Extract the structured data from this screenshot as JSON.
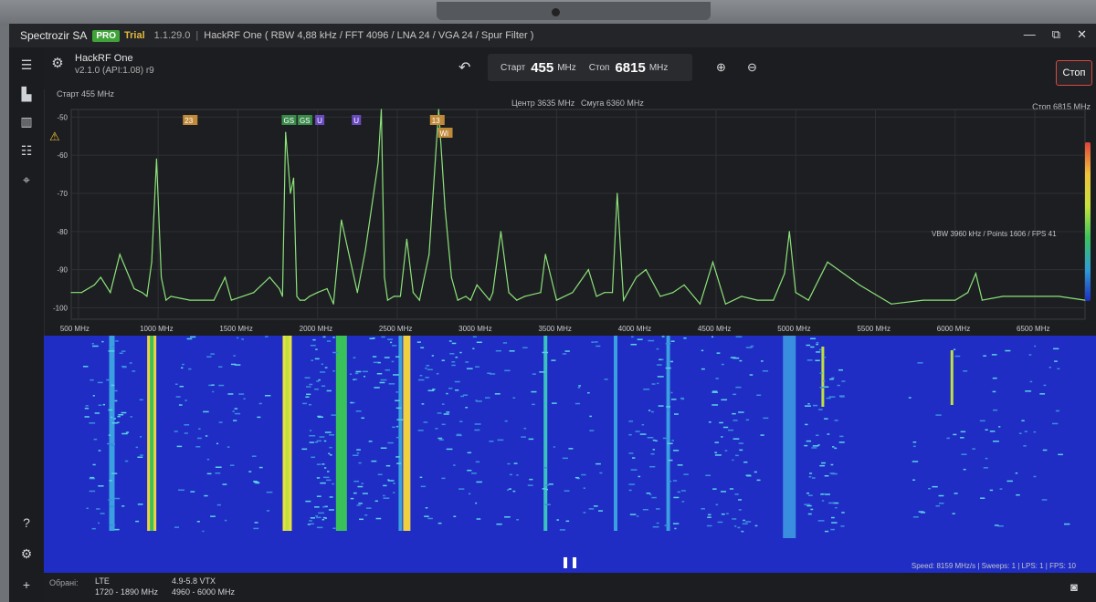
{
  "window": {
    "app_name": "Spectrozir SA",
    "badge_pro": "PRO",
    "badge_trial": "Trial",
    "version": "1.1.29.0",
    "separator": "|",
    "device_info": "HackRF One ( RBW 4,88 kHz / FFT 4096 / LNA 24 / VGA 24 / Spur Filter )",
    "controls": [
      "—",
      "⧉",
      "✕"
    ]
  },
  "device": {
    "name": "HackRF One",
    "version": "v2.1.0 (API:1.08) r9"
  },
  "frequency": {
    "start_label": "Старт",
    "start_value": "455",
    "stop_label": "Стоп",
    "stop_value": "6815",
    "unit": "MHz"
  },
  "stop_button": "Стоп",
  "info": {
    "start": "Старт 455 MHz",
    "center": "Центр 3635 MHz",
    "span": "Смуга 6360 MHz",
    "stop": "Стоп 6815 MHz"
  },
  "status": {
    "vbw": "VBW 3960 kHz / Points 1606 / FPS 41",
    "perf": "Speed: 8159 MHz/s | Sweeps: 1 | LPS: 1 | FPS: 10"
  },
  "footer": {
    "label": "Обрані:",
    "bands": [
      {
        "name": "LTE",
        "range": "1720 - 1890 MHz"
      },
      {
        "name": "4.9-5.8 VTX",
        "range": "4960 - 6000 MHz"
      }
    ]
  },
  "icons": {
    "sidebar": [
      "menu-icon",
      "chart-icon",
      "barcode-icon",
      "tune-icon",
      "pin-icon",
      "help-icon",
      "settings-icon",
      "add-icon"
    ]
  },
  "chart_data": {
    "type": "line",
    "x_tick_labels": [
      "500 MHz",
      "1000 MHz",
      "1500 MHz",
      "2000 MHz",
      "2500 MHz",
      "3000 MHz",
      "3500 MHz",
      "4000 MHz",
      "4500 MHz",
      "5000 MHz",
      "5500 MHz",
      "6000 MHz",
      "6500 MHz"
    ],
    "x_ticks": [
      500,
      1000,
      1500,
      2000,
      2500,
      3000,
      3500,
      4000,
      4500,
      5000,
      5500,
      6000,
      6500
    ],
    "y_tick_labels": [
      "-50",
      "-60",
      "-70",
      "-80",
      "-90",
      "-100"
    ],
    "y_ticks": [
      -50,
      -60,
      -70,
      -80,
      -90,
      -100
    ],
    "xlim": [
      455,
      6815
    ],
    "ylim": [
      -103,
      -48
    ],
    "grid": true,
    "series": [
      {
        "color": "#8be37a",
        "x": [
          455,
          520,
          600,
          640,
          700,
          760,
          850,
          900,
          930,
          960,
          990,
          1020,
          1050,
          1080,
          1200,
          1350,
          1420,
          1460,
          1600,
          1700,
          1760,
          1780,
          1800,
          1830,
          1850,
          1870,
          1890,
          1920,
          1950,
          2000,
          2060,
          2100,
          2150,
          2250,
          2300,
          2380,
          2400,
          2420,
          2440,
          2480,
          2520,
          2560,
          2600,
          2640,
          2700,
          2760,
          2800,
          2840,
          2880,
          2930,
          2960,
          3000,
          3080,
          3100,
          3150,
          3200,
          3250,
          3300,
          3400,
          3430,
          3500,
          3600,
          3700,
          3750,
          3800,
          3850,
          3880,
          3920,
          3960,
          4000,
          4060,
          4150,
          4230,
          4300,
          4400,
          4480,
          4560,
          4660,
          4760,
          4860,
          4930,
          4960,
          5000,
          5080,
          5200,
          5400,
          5600,
          5800,
          6000,
          6080,
          6130,
          6170,
          6300,
          6450,
          6550,
          6650,
          6815
        ],
        "y": [
          -96,
          -96,
          -94,
          -92,
          -96,
          -86,
          -95,
          -96,
          -97,
          -88,
          -61,
          -92,
          -98,
          -97,
          -98,
          -98,
          -92,
          -98,
          -96,
          -92,
          -95,
          -97,
          -54,
          -70,
          -66,
          -97,
          -98,
          -98,
          -97,
          -96,
          -95,
          -99,
          -77,
          -96,
          -85,
          -62,
          -48,
          -92,
          -98,
          -97,
          -97,
          -82,
          -96,
          -98,
          -86,
          -48,
          -74,
          -92,
          -98,
          -97,
          -98,
          -94,
          -98,
          -96,
          -80,
          -96,
          -98,
          -97,
          -96,
          -86,
          -98,
          -96,
          -90,
          -97,
          -96,
          -96,
          -70,
          -98,
          -95,
          -92,
          -90,
          -97,
          -96,
          -94,
          -99,
          -88,
          -99,
          -97,
          -98,
          -98,
          -91,
          -80,
          -96,
          -98,
          -88,
          -94,
          -99,
          -98,
          -98,
          -96,
          -91,
          -98,
          -97,
          -97,
          -97,
          -97,
          -98
        ]
      }
    ],
    "markers": [
      "23",
      "GS",
      "GS",
      "U",
      "U",
      "13",
      "Wi"
    ]
  }
}
